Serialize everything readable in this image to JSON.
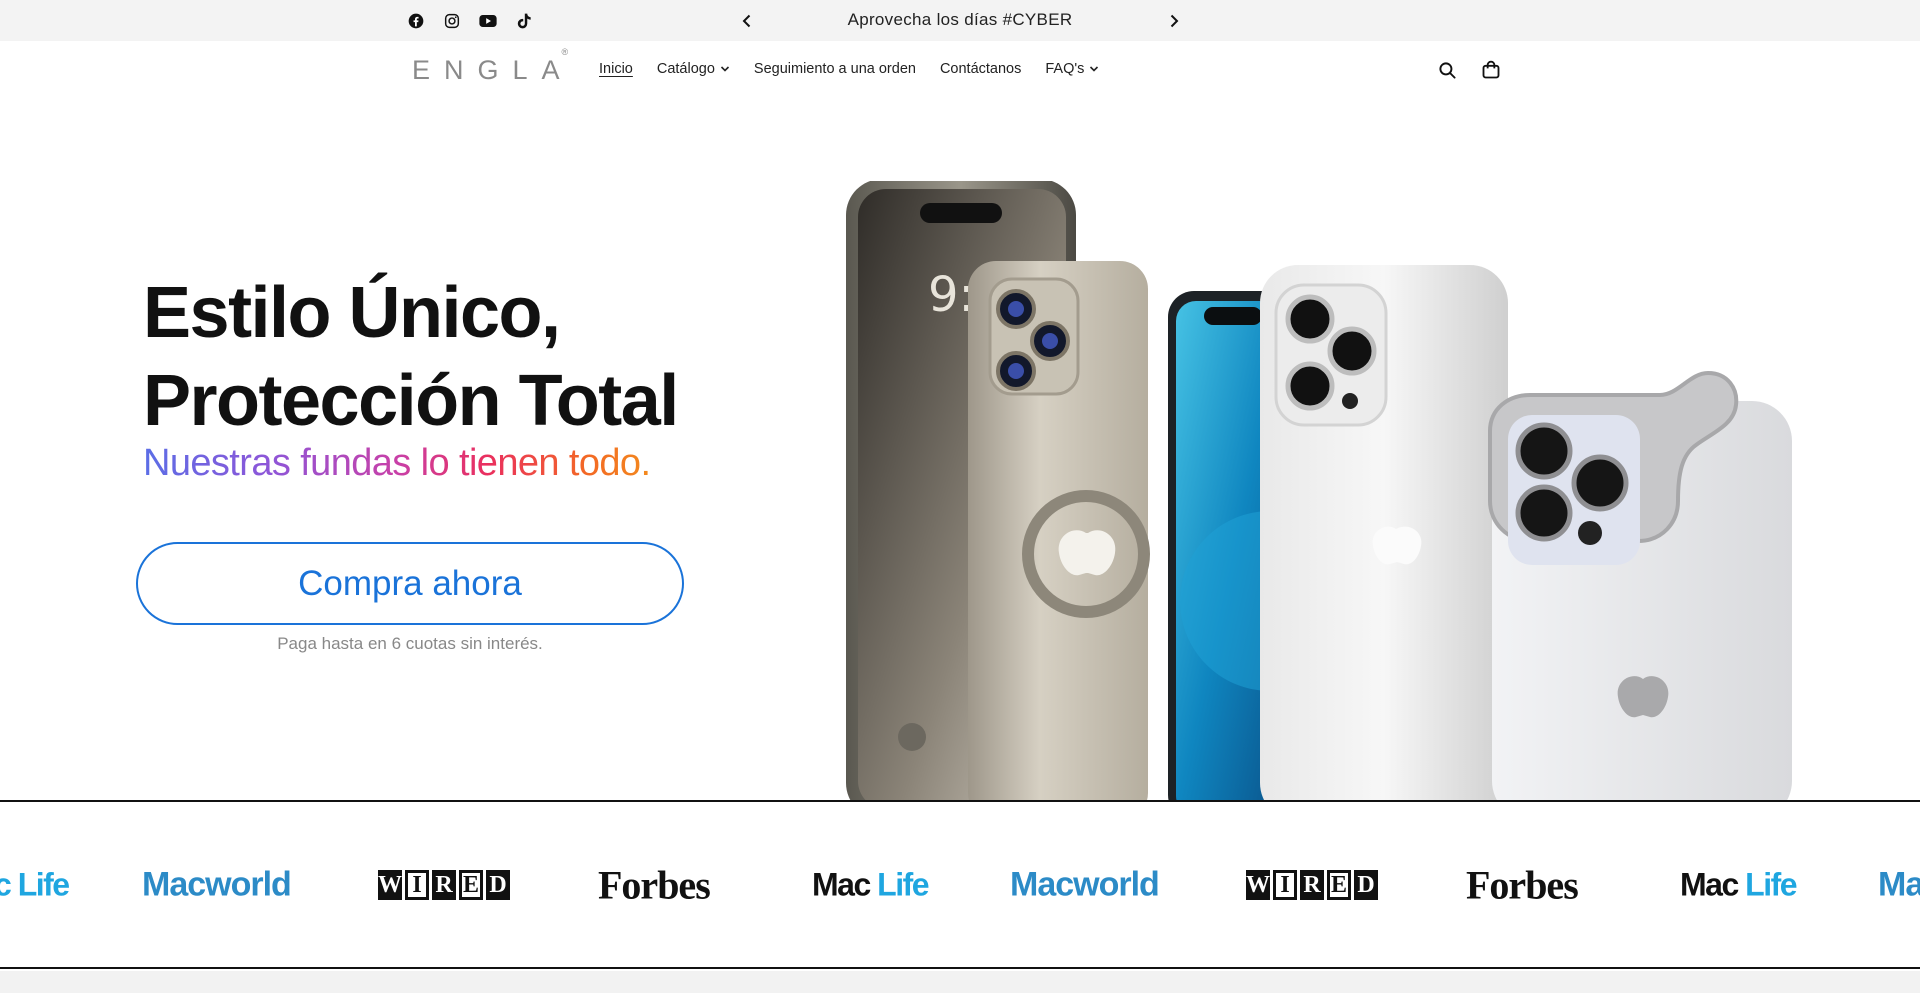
{
  "announcement": {
    "text": "Aprovecha los días #CYBER ",
    "socials": [
      "facebook-icon",
      "instagram-icon",
      "youtube-icon",
      "tiktok-icon"
    ]
  },
  "header": {
    "logo": "ENGLA",
    "logo_mark": "®",
    "nav": [
      {
        "label": "Inicio",
        "active": true,
        "dropdown": false
      },
      {
        "label": "Catálogo",
        "active": false,
        "dropdown": true
      },
      {
        "label": "Seguimiento a una orden",
        "active": false,
        "dropdown": false
      },
      {
        "label": "Contáctanos",
        "active": false,
        "dropdown": false
      },
      {
        "label": "FAQ's",
        "active": false,
        "dropdown": true
      }
    ],
    "icons": [
      "search-icon",
      "cart-icon"
    ]
  },
  "hero": {
    "title_line1": "Estilo Único,",
    "title_line2": "Protección Total",
    "subtitle": "Nuestras fundas lo tienen todo.",
    "cta_label": "Compra ahora",
    "cta_note": "Paga hasta en 6 cuotas sin interés.",
    "accent_color": "#1a73d9",
    "phone_lock_time": "9:"
  },
  "press": {
    "logos": [
      "Mac Life",
      "Macworld",
      "WIRED",
      "Forbes",
      "Mac Life",
      "Macworld",
      "WIRED",
      "Forbes",
      "Mac Life",
      "Ma"
    ],
    "maclife_a": "Mac",
    "maclife_b": "Life",
    "macworld": "Macworld",
    "forbes": "Forbes",
    "wired_letters": [
      "W",
      "I",
      "R",
      "E",
      "D"
    ],
    "first_partial": "c Life",
    "last_partial": "Ma"
  }
}
